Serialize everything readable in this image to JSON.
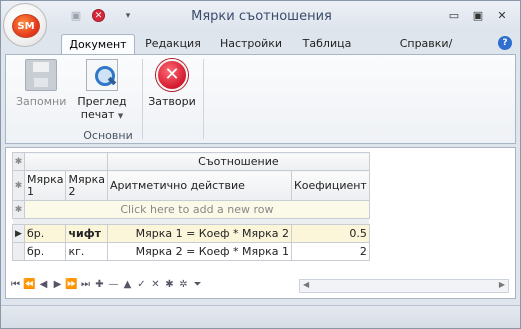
{
  "window": {
    "title": "Мярки съотношения"
  },
  "app_button": {
    "logo_text": "SM"
  },
  "tabs": [
    {
      "label": "Документ",
      "active": true
    },
    {
      "label": "Редакция"
    },
    {
      "label": "Настройки"
    },
    {
      "label": "Таблица"
    },
    {
      "label": "Справки/Скриптове"
    }
  ],
  "ribbon": {
    "save": {
      "label": "Запомни",
      "enabled": false
    },
    "preview": {
      "label_line1": "Преглед",
      "label_line2": "печат"
    },
    "close": {
      "label": "Затвори"
    },
    "group_label": "Основни"
  },
  "grid": {
    "group_header": "Съотношение",
    "columns": {
      "unit1": "Мярка 1",
      "unit2": "Мярка 2",
      "action": "Аритметично действие",
      "coef": "Коефициент"
    },
    "add_row_text": "Click here to add a new row",
    "rows": [
      {
        "unit1": "бр.",
        "unit2": "чифт",
        "action": "Мярка 1 = Коеф * Мярка 2",
        "coef": "0.5"
      },
      {
        "unit1": "бр.",
        "unit2": "кг.",
        "action": "Мярка 2 = Коеф * Мярка 1",
        "coef": "2"
      }
    ]
  },
  "icons": [
    "save-icon",
    "close-icon",
    "customize-icon",
    "minimize-icon",
    "maximize-icon",
    "window-close-icon",
    "help-icon",
    "print-preview-icon"
  ]
}
